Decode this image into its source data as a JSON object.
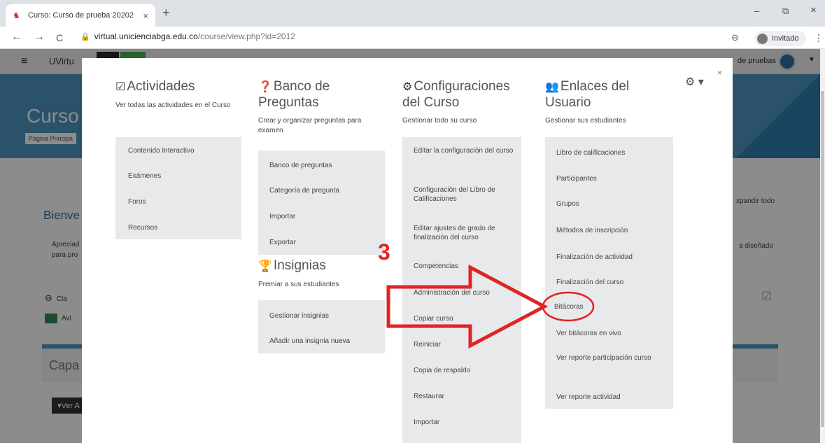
{
  "browser": {
    "tab_title": "Curso: Curso de prueba 20202",
    "tab_close": "×",
    "new_tab": "+",
    "min": "–",
    "restore": "⧉",
    "close": "×",
    "back": "←",
    "forward": "→",
    "reload": "C",
    "url_host": "virtual.unicienciabga.edu.co",
    "url_path": "/course/view.php?id=2012",
    "profile_label": "Invitado",
    "menu": "⋮"
  },
  "page": {
    "brand": "UVirtu",
    "user_name": "de pruebas",
    "course_title": "Curso",
    "breadcrumb": "Página Principa",
    "welcome": "Bienve",
    "intro_line1": "Apreciad",
    "intro_line2": "para pro",
    "expand_all": "xpandir todo",
    "designed": "a diseñado",
    "link1": "Cla",
    "link2": "Avi",
    "section_title": "Capa",
    "view_button": "Ver A"
  },
  "modal": {
    "close": "×",
    "col1": {
      "title": "Actividades",
      "desc": "Ver todas las actividades en el Curso",
      "items": [
        "Contenido Interactivo",
        "Exámenes",
        "Foros",
        "Recursos"
      ]
    },
    "col2": {
      "title_line1": "Banco de",
      "title_line2": "Preguntas",
      "desc": "Crear y organizar preguntas para examen",
      "items": [
        "Banco de preguntas",
        "Categoría de pregunta",
        "Importar",
        "Exportar"
      ],
      "badges_title": "Insignias",
      "badges_desc": "Premiar a sus estudiantes",
      "badges_items": [
        "Gestionar insignias",
        "Añadir una insignia nueva"
      ]
    },
    "col3": {
      "title_line1": "Configuraciones",
      "title_line2": "del Curso",
      "desc": "Gestionar todo su curso",
      "items": [
        "Editar la configuración del curso",
        "Configuración del Libro de Calificaciones",
        "Editar ajustes de grado de finalización del curso",
        "Competencias",
        "Administración del curso",
        "Copiar curso",
        "Reiniciar",
        "Copia de respaldo",
        "Restaurar",
        "Importar"
      ]
    },
    "col4": {
      "title_line1": "Enlaces del",
      "title_line2": "Usuario",
      "desc": "Gestionar sus estudiantes",
      "items": [
        "Libro de calificaciones",
        "Participantes",
        "Grupos",
        "Métodos de inscripción",
        "Finalización de actividad",
        "Finalización del curso",
        "Bitácoras",
        "Ver bitácoras en vivo",
        "Ver reporte participación curso",
        "Ver reporte actividad"
      ]
    }
  },
  "annotation": {
    "step_number": "3",
    "color": "#e02424"
  },
  "icons": {
    "activities": "checkbox-icon",
    "questions": "question-circle-icon",
    "config": "cogs-icon",
    "users": "users-icon",
    "badges": "trophy-icon",
    "settings": "gear-icon"
  }
}
